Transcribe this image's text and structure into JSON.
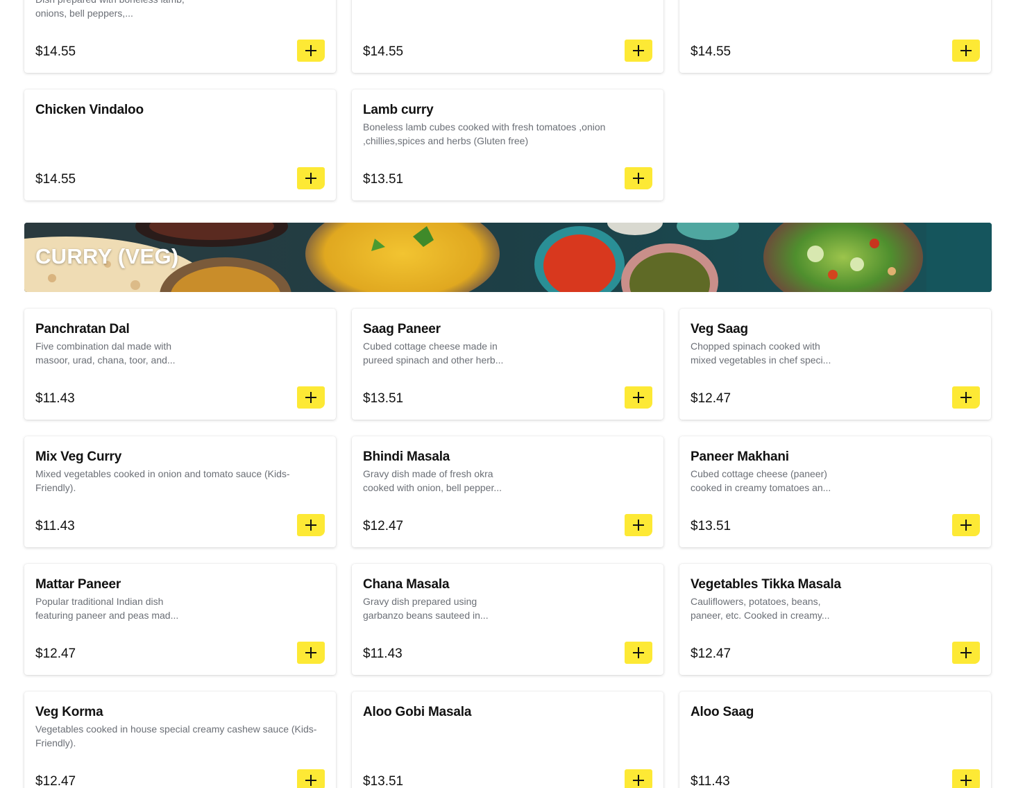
{
  "icons": {
    "add": "plus-icon"
  },
  "colors": {
    "add_button": "#fde935",
    "description_text": "#6b6f76"
  },
  "top_items": [
    {
      "name": "",
      "description": "Dish prepared with boneless lamb, onions, bell peppers,...",
      "price": "$14.55"
    },
    {
      "name": "",
      "description": "",
      "price": "$14.55"
    },
    {
      "name": "",
      "description": "",
      "price": "$14.55"
    },
    {
      "name": "Chicken Vindaloo",
      "description": "",
      "price": "$14.55"
    },
    {
      "name": "Lamb curry",
      "description": "Boneless lamb cubes cooked with fresh tomatoes ,onion ,chillies,spices and herbs (Gluten free)",
      "price": "$13.51"
    }
  ],
  "section": {
    "title": "CURRY (VEG)"
  },
  "veg_items": [
    {
      "name": "Panchratan Dal",
      "description": "Five combination dal made with masoor, urad, chana, toor, and...",
      "price": "$11.43"
    },
    {
      "name": "Saag Paneer",
      "description": "Cubed cottage cheese made in pureed spinach and other herb...",
      "price": "$13.51"
    },
    {
      "name": "Veg Saag",
      "description": "Chopped spinach cooked with mixed vegetables in chef speci...",
      "price": "$12.47"
    },
    {
      "name": "Mix Veg Curry",
      "description": "Mixed vegetables cooked in onion and tomato sauce (Kids-Friendly).",
      "price": "$11.43"
    },
    {
      "name": "Bhindi Masala",
      "description": "Gravy dish made of fresh okra cooked with onion, bell pepper...",
      "price": "$12.47"
    },
    {
      "name": "Paneer Makhani",
      "description": "Cubed cottage cheese (paneer) cooked in creamy tomatoes an...",
      "price": "$13.51"
    },
    {
      "name": "Mattar Paneer",
      "description": "Popular traditional Indian dish featuring paneer and peas mad...",
      "price": "$12.47"
    },
    {
      "name": "Chana Masala",
      "description": "Gravy dish prepared using garbanzo beans sauteed in...",
      "price": "$11.43"
    },
    {
      "name": "Vegetables Tikka Masala",
      "description": "Cauliflowers, potatoes, beans, paneer, etc. Cooked in creamy...",
      "price": "$12.47"
    },
    {
      "name": "Veg Korma",
      "description": "Vegetables cooked in house special creamy cashew sauce (Kids-Friendly).",
      "price": "$12.47"
    },
    {
      "name": "Aloo Gobi Masala",
      "description": "",
      "price": "$13.51"
    },
    {
      "name": "Aloo Saag",
      "description": "",
      "price": "$11.43"
    }
  ]
}
